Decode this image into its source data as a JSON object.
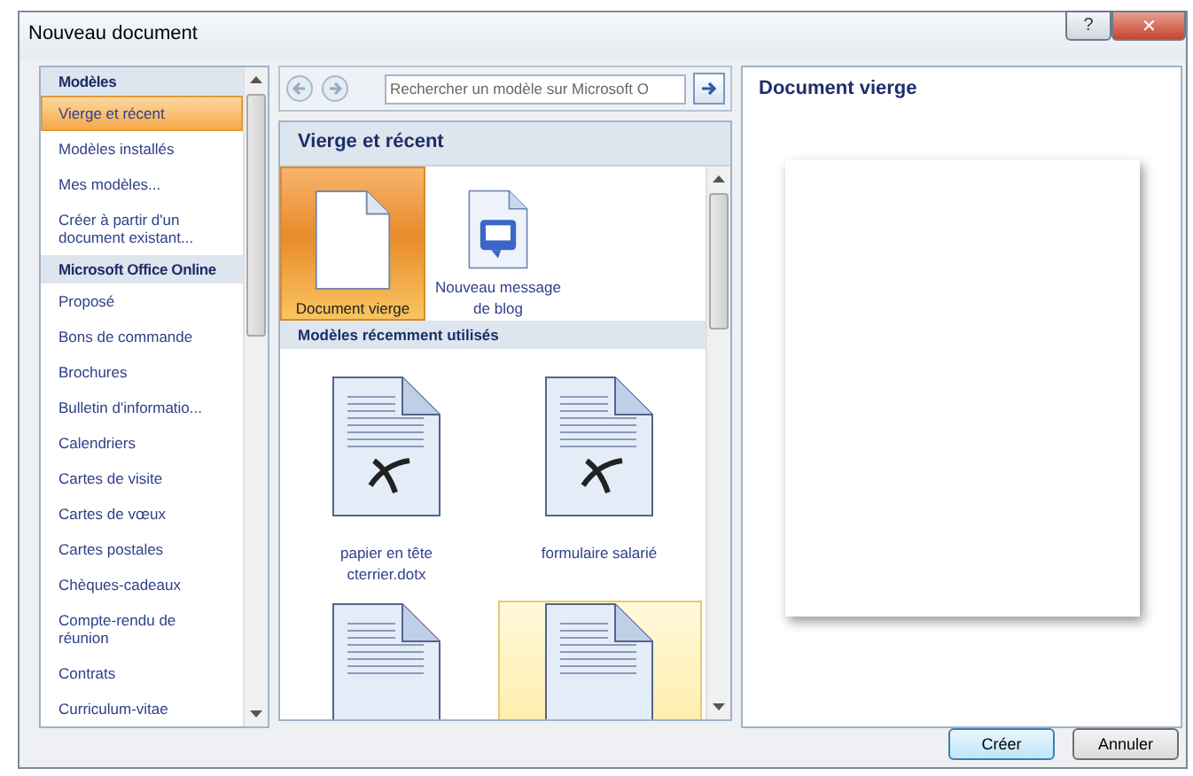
{
  "window": {
    "title": "Nouveau document",
    "controls": [
      "?",
      "✕"
    ]
  },
  "sidebar": {
    "items": [
      {
        "kind": "header",
        "label": "Modèles",
        "selected": false
      },
      {
        "kind": "item",
        "label": "Vierge et récent",
        "selected": true
      },
      {
        "kind": "item",
        "label": "Modèles installés",
        "selected": false
      },
      {
        "kind": "item",
        "label": "Mes modèles...",
        "selected": false
      },
      {
        "kind": "item",
        "label": "Créer à partir d'un document existant...",
        "selected": false
      },
      {
        "kind": "header",
        "label": "Microsoft Office Online",
        "selected": false
      },
      {
        "kind": "item",
        "label": "Proposé",
        "selected": false
      },
      {
        "kind": "item",
        "label": "Bons de commande",
        "selected": false
      },
      {
        "kind": "item",
        "label": "Brochures",
        "selected": false
      },
      {
        "kind": "item",
        "label": "Bulletin d'informatio...",
        "selected": false
      },
      {
        "kind": "item",
        "label": "Calendriers",
        "selected": false
      },
      {
        "kind": "item",
        "label": "Cartes de visite",
        "selected": false
      },
      {
        "kind": "item",
        "label": "Cartes de vœux",
        "selected": false
      },
      {
        "kind": "item",
        "label": "Cartes postales",
        "selected": false
      },
      {
        "kind": "item",
        "label": "Chèques-cadeaux",
        "selected": false
      },
      {
        "kind": "item",
        "label": "Compte-rendu de réunion",
        "selected": false
      },
      {
        "kind": "item",
        "label": "Contrats",
        "selected": false
      },
      {
        "kind": "item",
        "label": "Curriculum-vitae",
        "selected": false
      }
    ]
  },
  "search": {
    "placeholder": "Rechercher un modèle sur Microsoft O"
  },
  "gallery": {
    "title": "Vierge et récent",
    "sections": [
      {
        "kind": "small",
        "tiles": [
          {
            "kind": "blank",
            "label": "Document vierge",
            "selected": true,
            "highlighted": false
          },
          {
            "kind": "blog",
            "label": "Nouveau message de blog",
            "selected": false,
            "highlighted": false
          }
        ]
      },
      {
        "kind": "large",
        "title": "Modèles récemment utilisés",
        "tiles": [
          {
            "kind": "template",
            "label": "papier en tête cterrier.dotx",
            "selected": false,
            "highlighted": false
          },
          {
            "kind": "template",
            "label": "formulaire salarié",
            "selected": false,
            "highlighted": false
          },
          {
            "kind": "lines",
            "selected": false,
            "highlighted": false
          },
          {
            "kind": "lines",
            "selected": false,
            "highlighted": true
          }
        ]
      }
    ]
  },
  "preview": {
    "title": "Document vierge"
  },
  "buttons": [
    {
      "label": "Créer",
      "default": true
    },
    {
      "label": "Annuler",
      "default": false
    }
  ]
}
